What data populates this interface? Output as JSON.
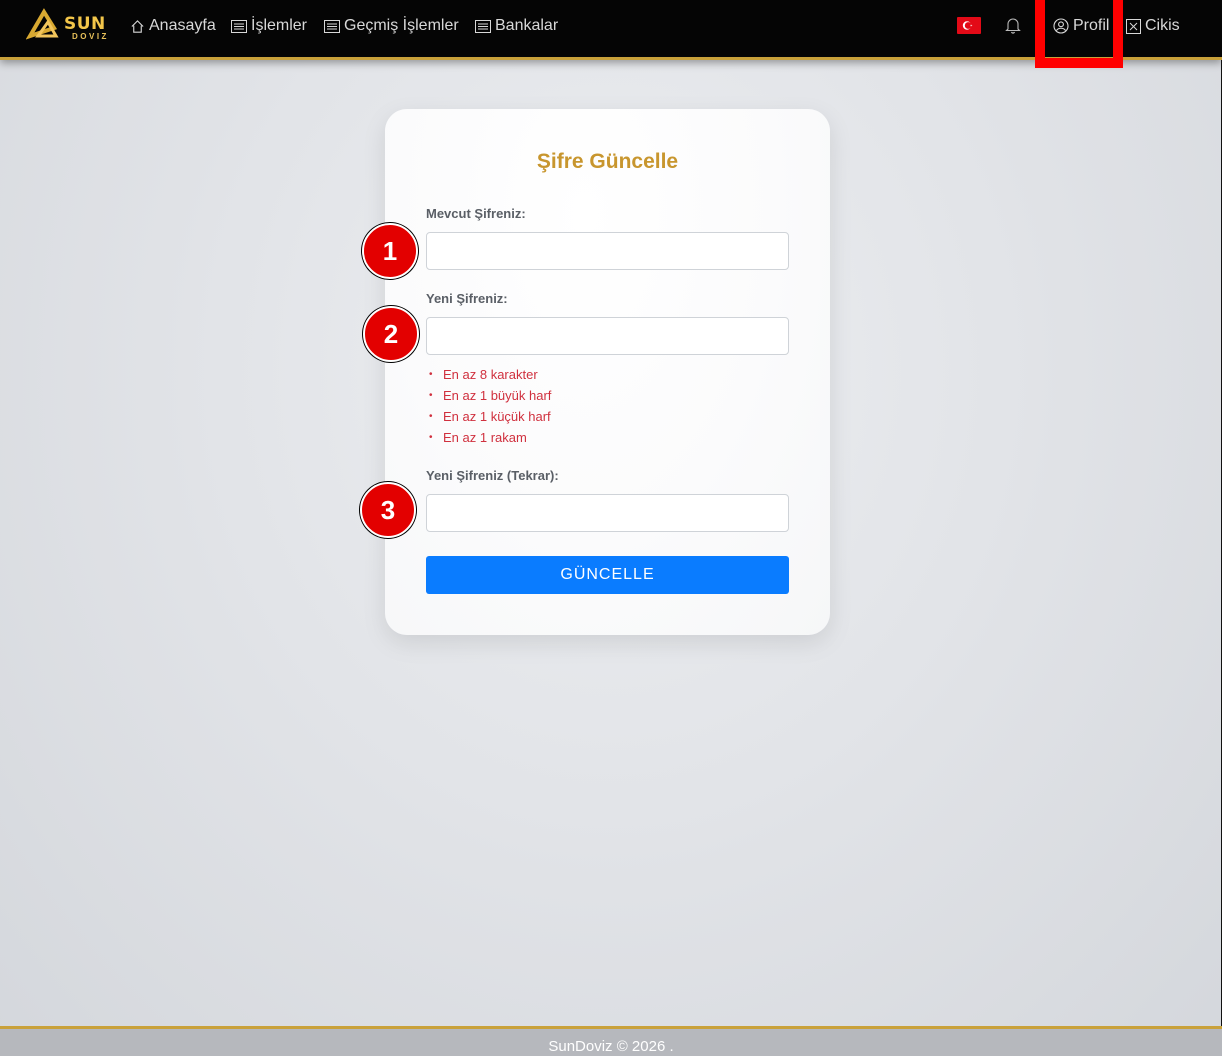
{
  "navbar": {
    "logo": {
      "main": "SUN",
      "sub": "DOVIZ"
    },
    "links": [
      {
        "label": "Anasayfa",
        "icon": "home-icon"
      },
      {
        "label": "İşlemler",
        "icon": "list-icon"
      },
      {
        "label": "Geçmiş İşlemler",
        "icon": "list-icon"
      },
      {
        "label": "Bankalar",
        "icon": "list-icon"
      }
    ],
    "language_flag": "turkey-flag-icon",
    "notifications_icon": "bell-icon",
    "profile": {
      "label": "Profil",
      "icon": "user-circle-icon"
    },
    "logout": {
      "label": "Cikis",
      "icon": "close-box-icon"
    }
  },
  "form": {
    "title": "Şifre Güncelle",
    "current_password": {
      "label": "Mevcut Şifreniz:",
      "value": ""
    },
    "new_password": {
      "label": "Yeni Şifreniz:",
      "value": ""
    },
    "rules": [
      "En az 8 karakter",
      "En az 1 büyük harf",
      "En az 1 küçük harf",
      "En az 1 rakam"
    ],
    "confirm_password": {
      "label": "Yeni Şifreniz (Tekrar):",
      "value": ""
    },
    "submit_label": "GÜNCELLE"
  },
  "annotations": {
    "badges": [
      "1",
      "2",
      "3"
    ],
    "highlight_color": "#ff0000"
  },
  "footer": {
    "text": "SunDoviz © 2026 ."
  },
  "colors": {
    "accent_gold": "#c8962e",
    "primary_button": "#0a7cff",
    "rule_text": "#d0303e"
  }
}
